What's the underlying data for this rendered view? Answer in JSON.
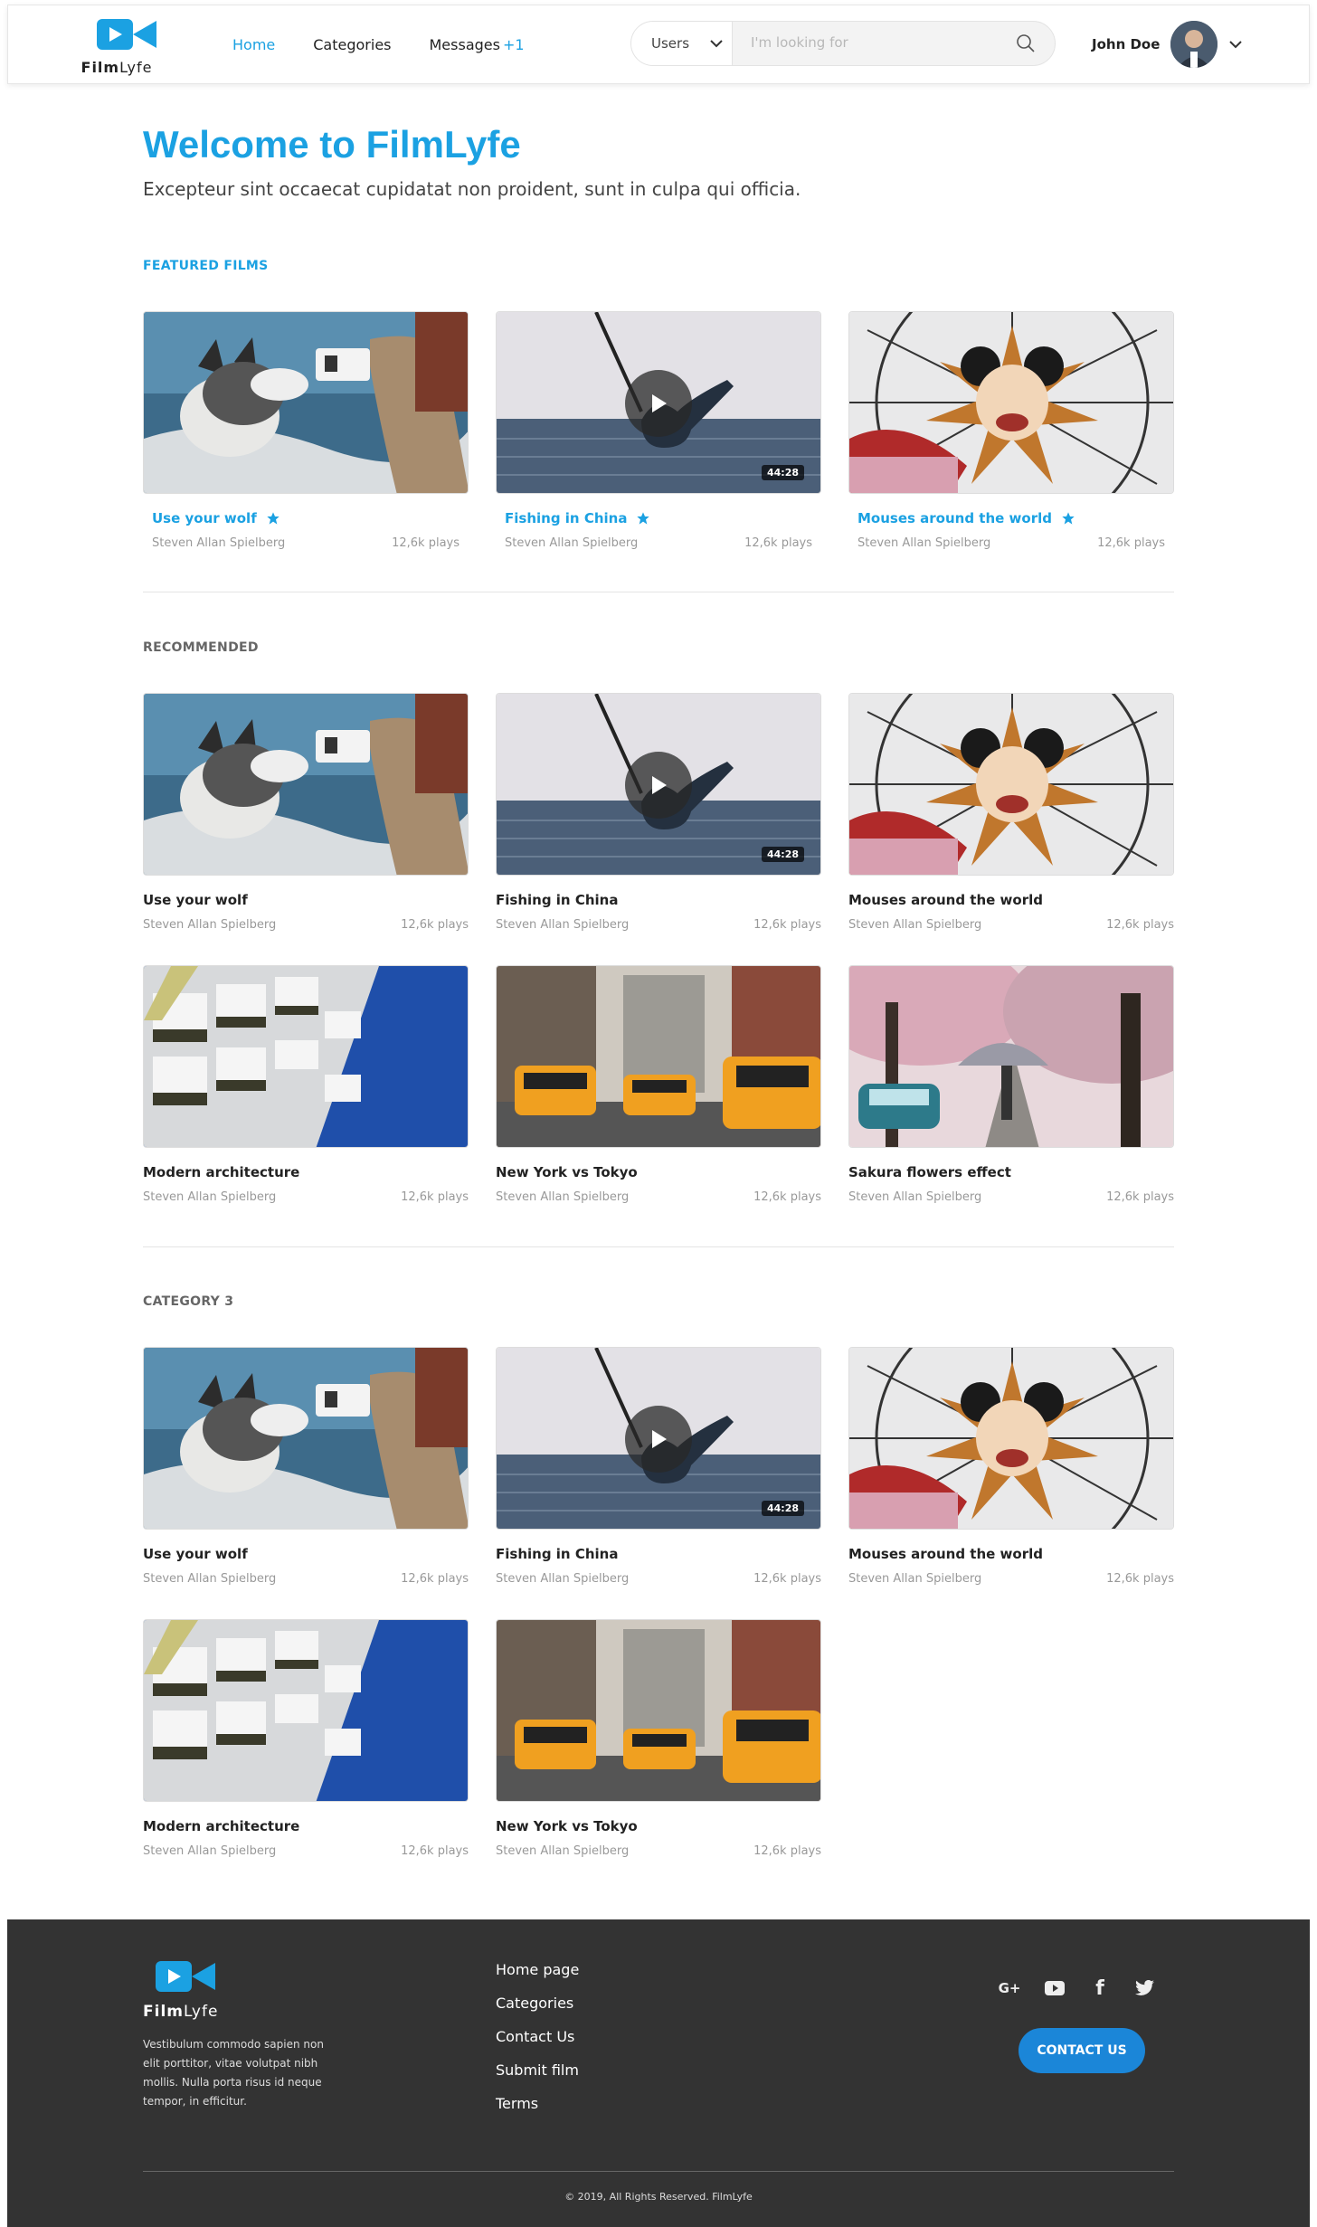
{
  "brand": {
    "name_bold": "Film",
    "name_light": "Lyfe",
    "accent": "#1ba1e2"
  },
  "nav": {
    "home": "Home",
    "categories": "Categories",
    "messages": "Messages",
    "messages_badge": "+1"
  },
  "search": {
    "scope": "Users",
    "placeholder": "I'm looking for"
  },
  "user": {
    "name": "John Doe"
  },
  "hero": {
    "title": "Welcome to FilmLyfe",
    "subtitle": "Excepteur sint occaecat cupidatat non proident, sunt in culpa qui officia."
  },
  "sections": {
    "featured": {
      "label": "FEATURED FILMS",
      "items": [
        {
          "title": "Use your wolf",
          "author": "Steven Allan Spielberg",
          "plays": "12,6k plays"
        },
        {
          "title": "Fishing in China",
          "author": "Steven Allan Spielberg",
          "plays": "12,6k plays",
          "duration": "44:28"
        },
        {
          "title": "Mouses around the world",
          "author": "Steven Allan Spielberg",
          "plays": "12,6k plays"
        }
      ]
    },
    "recommended": {
      "label": "RECOMMENDED",
      "items": [
        {
          "title": "Use your wolf",
          "author": "Steven Allan Spielberg",
          "plays": "12,6k plays"
        },
        {
          "title": "Fishing in China",
          "author": "Steven Allan Spielberg",
          "plays": "12,6k plays",
          "duration": "44:28"
        },
        {
          "title": "Mouses around the world",
          "author": "Steven Allan Spielberg",
          "plays": "12,6k plays"
        },
        {
          "title": "Modern architecture",
          "author": "Steven Allan Spielberg",
          "plays": "12,6k plays"
        },
        {
          "title": "New York vs Tokyo",
          "author": "Steven Allan Spielberg",
          "plays": "12,6k plays"
        },
        {
          "title": "Sakura flowers effect",
          "author": "Steven Allan Spielberg",
          "plays": "12,6k plays"
        }
      ]
    },
    "category3": {
      "label": "CATEGORY 3",
      "items": [
        {
          "title": "Use your wolf",
          "author": "Steven Allan Spielberg",
          "plays": "12,6k plays"
        },
        {
          "title": "Fishing in China",
          "author": "Steven Allan Spielberg",
          "plays": "12,6k plays",
          "duration": "44:28"
        },
        {
          "title": "Mouses around the world",
          "author": "Steven Allan Spielberg",
          "plays": "12,6k plays"
        },
        {
          "title": "Modern architecture",
          "author": "Steven Allan Spielberg",
          "plays": "12,6k plays"
        },
        {
          "title": "New York vs Tokyo",
          "author": "Steven Allan Spielberg",
          "plays": "12,6k plays"
        }
      ]
    }
  },
  "footer": {
    "description": "Vestibulum commodo sapien non elit porttitor, vitae volutpat nibh mollis. Nulla porta risus id neque tempor, in efficitur.",
    "links": [
      "Home page",
      "Categories",
      "Contact Us",
      "Submit film",
      "Terms"
    ],
    "social": [
      "G+",
      "youtube-icon",
      "f",
      "twitter-icon"
    ],
    "contact_button": "CONTACT US",
    "copyright": "© 2019, All Rights Reserved. FilmLyfe"
  }
}
